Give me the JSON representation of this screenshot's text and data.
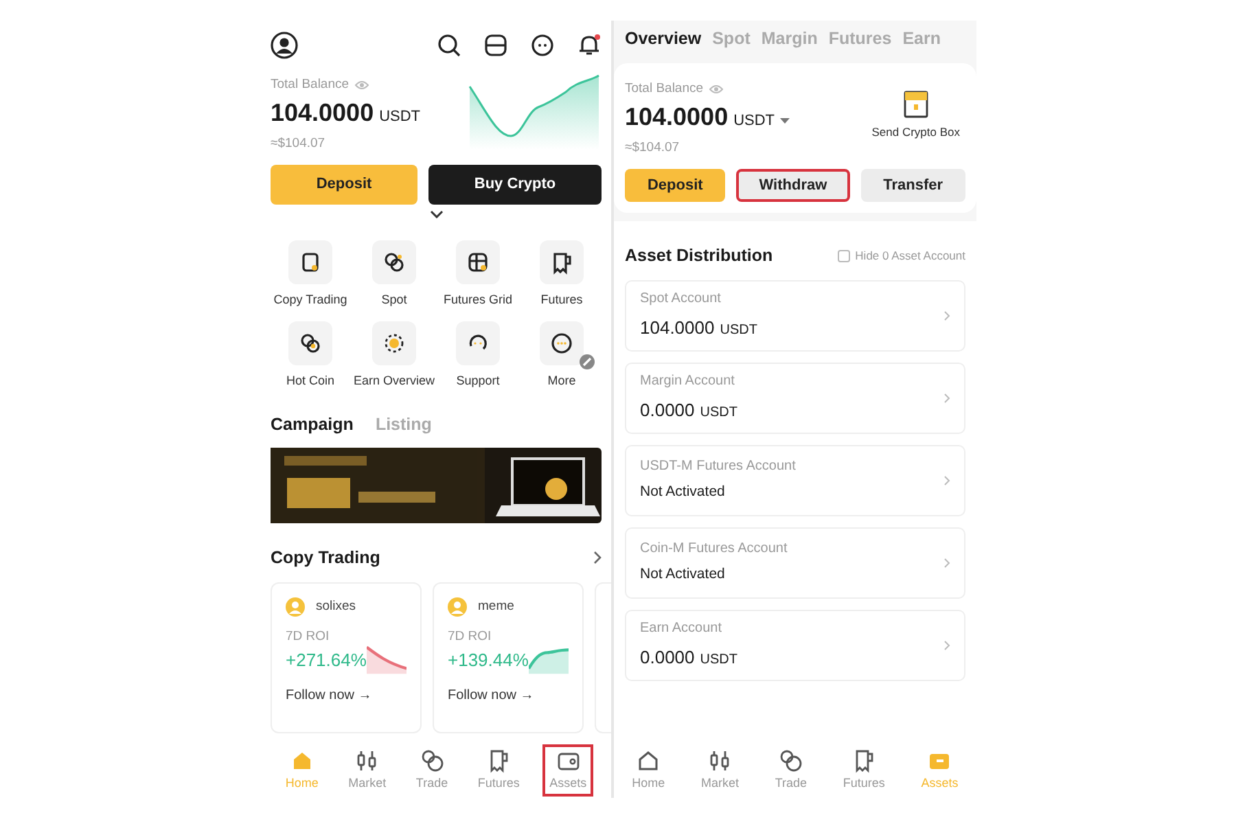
{
  "home": {
    "balance": {
      "label": "Total Balance",
      "amount": "104.0000",
      "unit": "USDT",
      "fiat": "≈$104.07"
    },
    "buttons": [
      {
        "label": "Deposit",
        "kind": "primary"
      },
      {
        "label": "Buy Crypto",
        "kind": "dark"
      }
    ],
    "shortcuts": [
      "Copy Trading",
      "Spot",
      "Futures Grid",
      "Futures",
      "Hot Coin",
      "Earn Overview",
      "Support",
      "More"
    ],
    "campaign_tabs": [
      {
        "label": "Campaign",
        "selected": true
      },
      {
        "label": "Listing",
        "selected": false
      }
    ],
    "copy_trading": {
      "title": "Copy Trading",
      "traders": [
        {
          "name": "solixes",
          "roi_label": "7D ROI",
          "roi": "+271.64%",
          "action": "Follow now →"
        },
        {
          "name": "meme",
          "roi_label": "7D ROI",
          "roi": "+139.44%",
          "action": "Follow now →"
        }
      ]
    },
    "nav": [
      {
        "label": "Home",
        "selected": true,
        "highlighted": false
      },
      {
        "label": "Market",
        "selected": false,
        "highlighted": false
      },
      {
        "label": "Trade",
        "selected": false,
        "highlighted": false
      },
      {
        "label": "Futures",
        "selected": false,
        "highlighted": false
      },
      {
        "label": "Assets",
        "selected": false,
        "highlighted": true
      }
    ]
  },
  "assets": {
    "tabs": [
      {
        "label": "Overview",
        "selected": true
      },
      {
        "label": "Spot",
        "selected": false
      },
      {
        "label": "Margin",
        "selected": false
      },
      {
        "label": "Futures",
        "selected": false
      },
      {
        "label": "Earn",
        "selected": false
      }
    ],
    "balance": {
      "label": "Total Balance",
      "amount": "104.0000",
      "unit": "USDT",
      "fiat": "≈$104.07"
    },
    "send_box": "Send Crypto Box",
    "buttons": [
      {
        "label": "Deposit",
        "kind": "primary",
        "highlighted": false
      },
      {
        "label": "Withdraw",
        "kind": "light",
        "highlighted": true
      },
      {
        "label": "Transfer",
        "kind": "light",
        "highlighted": false
      }
    ],
    "distribution": {
      "title": "Asset Distribution",
      "hide_zero": {
        "label": "Hide 0 Asset Account",
        "checked": false
      },
      "accounts": [
        {
          "name": "Spot Account",
          "value": "104.0000",
          "unit": "USDT"
        },
        {
          "name": "Margin Account",
          "value": "0.0000",
          "unit": "USDT"
        },
        {
          "name": "USDT-M Futures Account",
          "value": "Not Activated"
        },
        {
          "name": "Coin-M Futures Account",
          "value": "Not Activated"
        },
        {
          "name": "Earn Account",
          "value": "0.0000",
          "unit": "USDT"
        }
      ]
    },
    "nav": [
      {
        "label": "Home",
        "selected": false
      },
      {
        "label": "Market",
        "selected": false
      },
      {
        "label": "Trade",
        "selected": false
      },
      {
        "label": "Futures",
        "selected": false
      },
      {
        "label": "Assets",
        "selected": true
      }
    ]
  }
}
